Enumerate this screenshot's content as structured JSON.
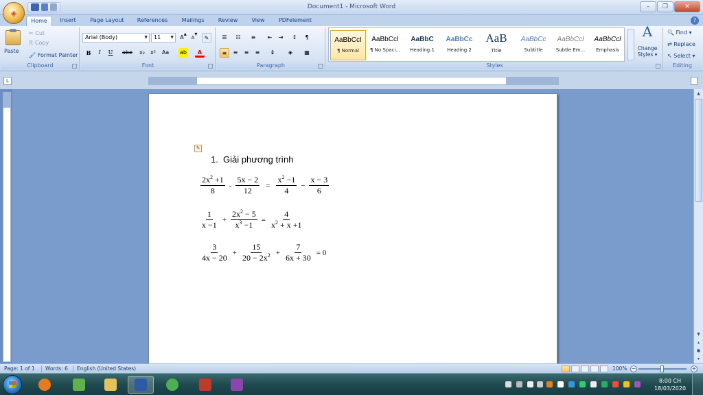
{
  "window": {
    "title": "Document1 - Microsoft Word"
  },
  "tabs": [
    "Home",
    "Insert",
    "Page Layout",
    "References",
    "Mailings",
    "Review",
    "View",
    "PDFelement"
  ],
  "clipboard": {
    "paste": "Paste",
    "cut": "Cut",
    "copy": "Copy",
    "format_painter": "Format Painter",
    "label": "Clipboard"
  },
  "font": {
    "name": "Arial (Body)",
    "size": "11",
    "bold": "B",
    "italic": "I",
    "underline": "U",
    "strike": "abe",
    "sub": "x₂",
    "sup": "x²",
    "case": "Aa",
    "label": "Font"
  },
  "paragraph": {
    "label": "Paragraph"
  },
  "styles": {
    "items": [
      {
        "sample": "AaBbCcI",
        "name": "¶ Normal"
      },
      {
        "sample": "AaBbCcI",
        "name": "¶ No Spaci..."
      },
      {
        "sample": "AaBbC",
        "name": "Heading 1"
      },
      {
        "sample": "AaBbCc",
        "name": "Heading 2"
      },
      {
        "sample": "AaB",
        "name": "Title"
      },
      {
        "sample": "AaBbCc",
        "name": "Subtitle"
      },
      {
        "sample": "AaBbCcl",
        "name": "Subtle Em..."
      },
      {
        "sample": "AaBbCcl",
        "name": "Emphasis"
      }
    ],
    "change_line1": "Change",
    "change_line2": "Styles ▾",
    "label": "Styles"
  },
  "editing": {
    "find": "Find ▾",
    "replace": "Replace",
    "select": "Select ▾",
    "label": "Editing"
  },
  "document": {
    "list_number": "1.",
    "list_text": "Giải phương trình",
    "eq1": {
      "f1n_a": "2x",
      "f1n_sup": "2",
      "f1n_b": " +1",
      "f1d": "8",
      "op1": "-",
      "f2n": "5x − 2",
      "f2d": "12",
      "eq": "=",
      "f3n_a": "x",
      "f3n_sup": "2",
      "f3n_b": " −1",
      "f3d": "4",
      "op2": "−",
      "f4n": "x − 3",
      "f4d": "6"
    },
    "eq2": {
      "f1n": "1",
      "f1d": "x −1",
      "op1": "+",
      "f2n_a": "2x",
      "f2n_sup": "2",
      "f2n_b": " − 5",
      "f2d_a": "x",
      "f2d_sup": "3",
      "f2d_b": " −1",
      "eq": "=",
      "f3n": "4",
      "f3d_a": "x",
      "f3d_sup": "2",
      "f3d_b": " + x +1"
    },
    "eq3": {
      "f1n": "3",
      "f1d": "4x − 20",
      "op1": "+",
      "f2n": "15",
      "f2d_a": "20 − 2x",
      "f2d_sup": "2",
      "op2": "+",
      "f3n": "7",
      "f3d": "6x + 30",
      "rhs": "= 0"
    }
  },
  "status": {
    "page": "Page: 1 of 1",
    "words": "Words: 6",
    "language": "English (United States)",
    "zoom": "100%"
  },
  "taskbar": {
    "time": "8:00 CH",
    "date": "18/03/2020"
  }
}
